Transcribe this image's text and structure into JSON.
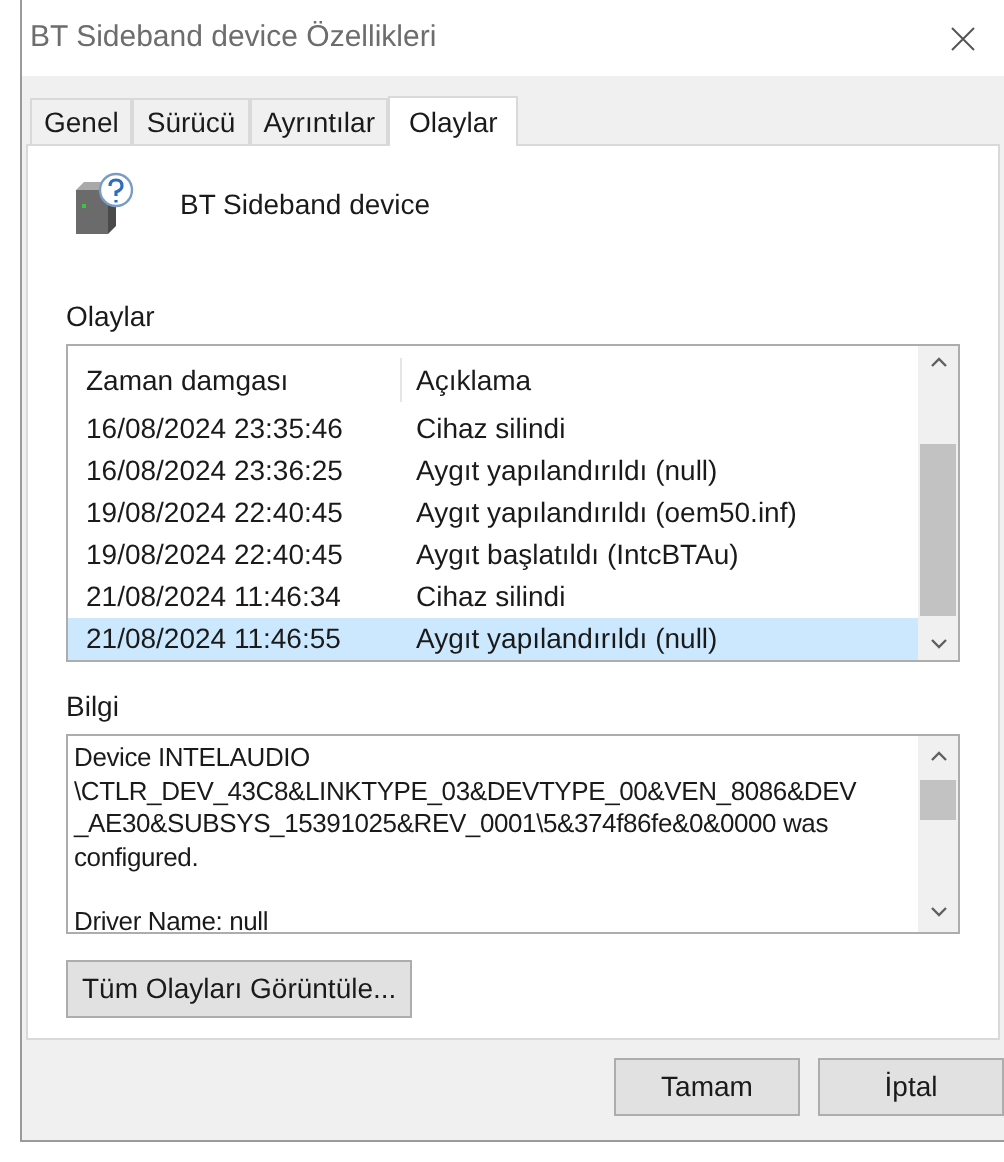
{
  "window": {
    "title": "BT Sideband device Özellikleri"
  },
  "tabs": [
    {
      "label": "Genel",
      "selected": false
    },
    {
      "label": "Sürücü",
      "selected": false
    },
    {
      "label": "Ayrıntılar",
      "selected": false
    },
    {
      "label": "Olaylar",
      "selected": true
    }
  ],
  "device": {
    "name": "BT Sideband device"
  },
  "events": {
    "label": "Olaylar",
    "columns": [
      "Zaman damgası",
      "Açıklama"
    ],
    "rows": [
      {
        "time": "16/08/2024 23:35:46",
        "description": "Cihaz silindi",
        "selected": false
      },
      {
        "time": "16/08/2024 23:36:25",
        "description": "Aygıt yapılandırıldı (null)",
        "selected": false
      },
      {
        "time": "19/08/2024 22:40:45",
        "description": "Aygıt yapılandırıldı (oem50.inf)",
        "selected": false
      },
      {
        "time": "19/08/2024 22:40:45",
        "description": "Aygıt başlatıldı (IntcBTAu)",
        "selected": false
      },
      {
        "time": "21/08/2024 11:46:34",
        "description": "Cihaz silindi",
        "selected": false
      },
      {
        "time": "21/08/2024 11:46:55",
        "description": "Aygıt yapılandırıldı (null)",
        "selected": true
      }
    ]
  },
  "info": {
    "label": "Bilgi",
    "paragraphs": [
      "Device INTELAUDIO\n\\CTLR_DEV_43C8&LINKTYPE_03&DEVTYPE_00&VEN_8086&DEV\n_AE30&SUBSYS_15391025&REV_0001\\5&374f86fe&0&0000 was\nconfigured.",
      "Driver Name: null"
    ]
  },
  "view_all_button": "Tüm Olayları Görüntüle...",
  "buttons": [
    "Tamam",
    "İptal"
  ]
}
